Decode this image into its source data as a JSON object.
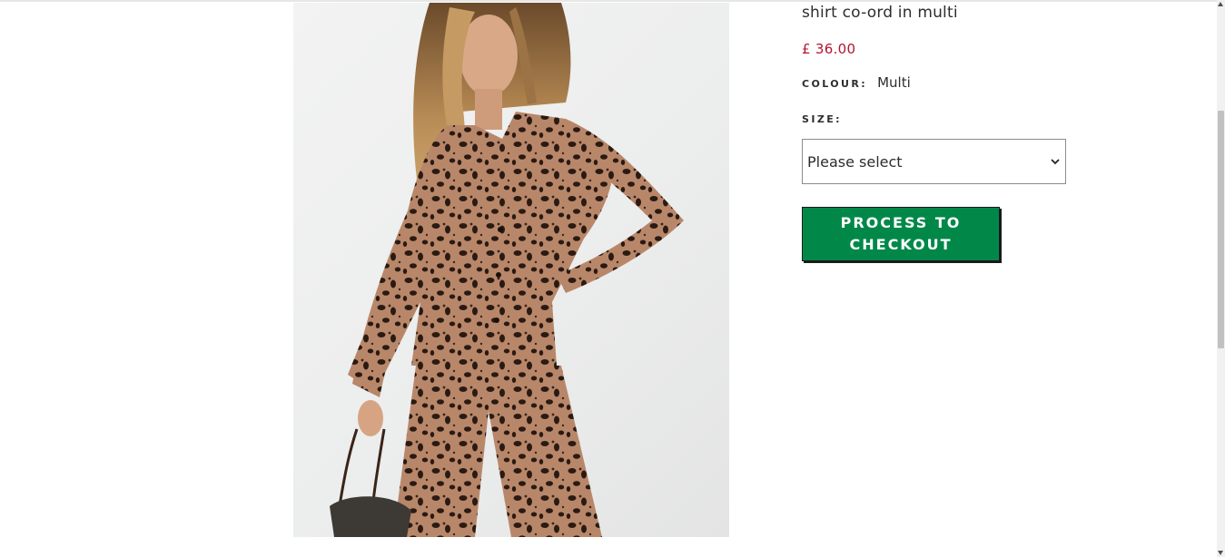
{
  "product": {
    "title": "shirt co-ord in multi",
    "price": "£ 36.00",
    "colour_label": "COLOUR:",
    "colour_value": "Multi",
    "size_label": "SIZE:",
    "size_placeholder": "Please select",
    "checkout_label": "PROCESS TO CHECKOUT",
    "image_icon": "leopard-print-co-ord-photo"
  },
  "colors": {
    "price": "#b4142d",
    "checkout_button": "#018849",
    "text": "#2d2d2d"
  }
}
